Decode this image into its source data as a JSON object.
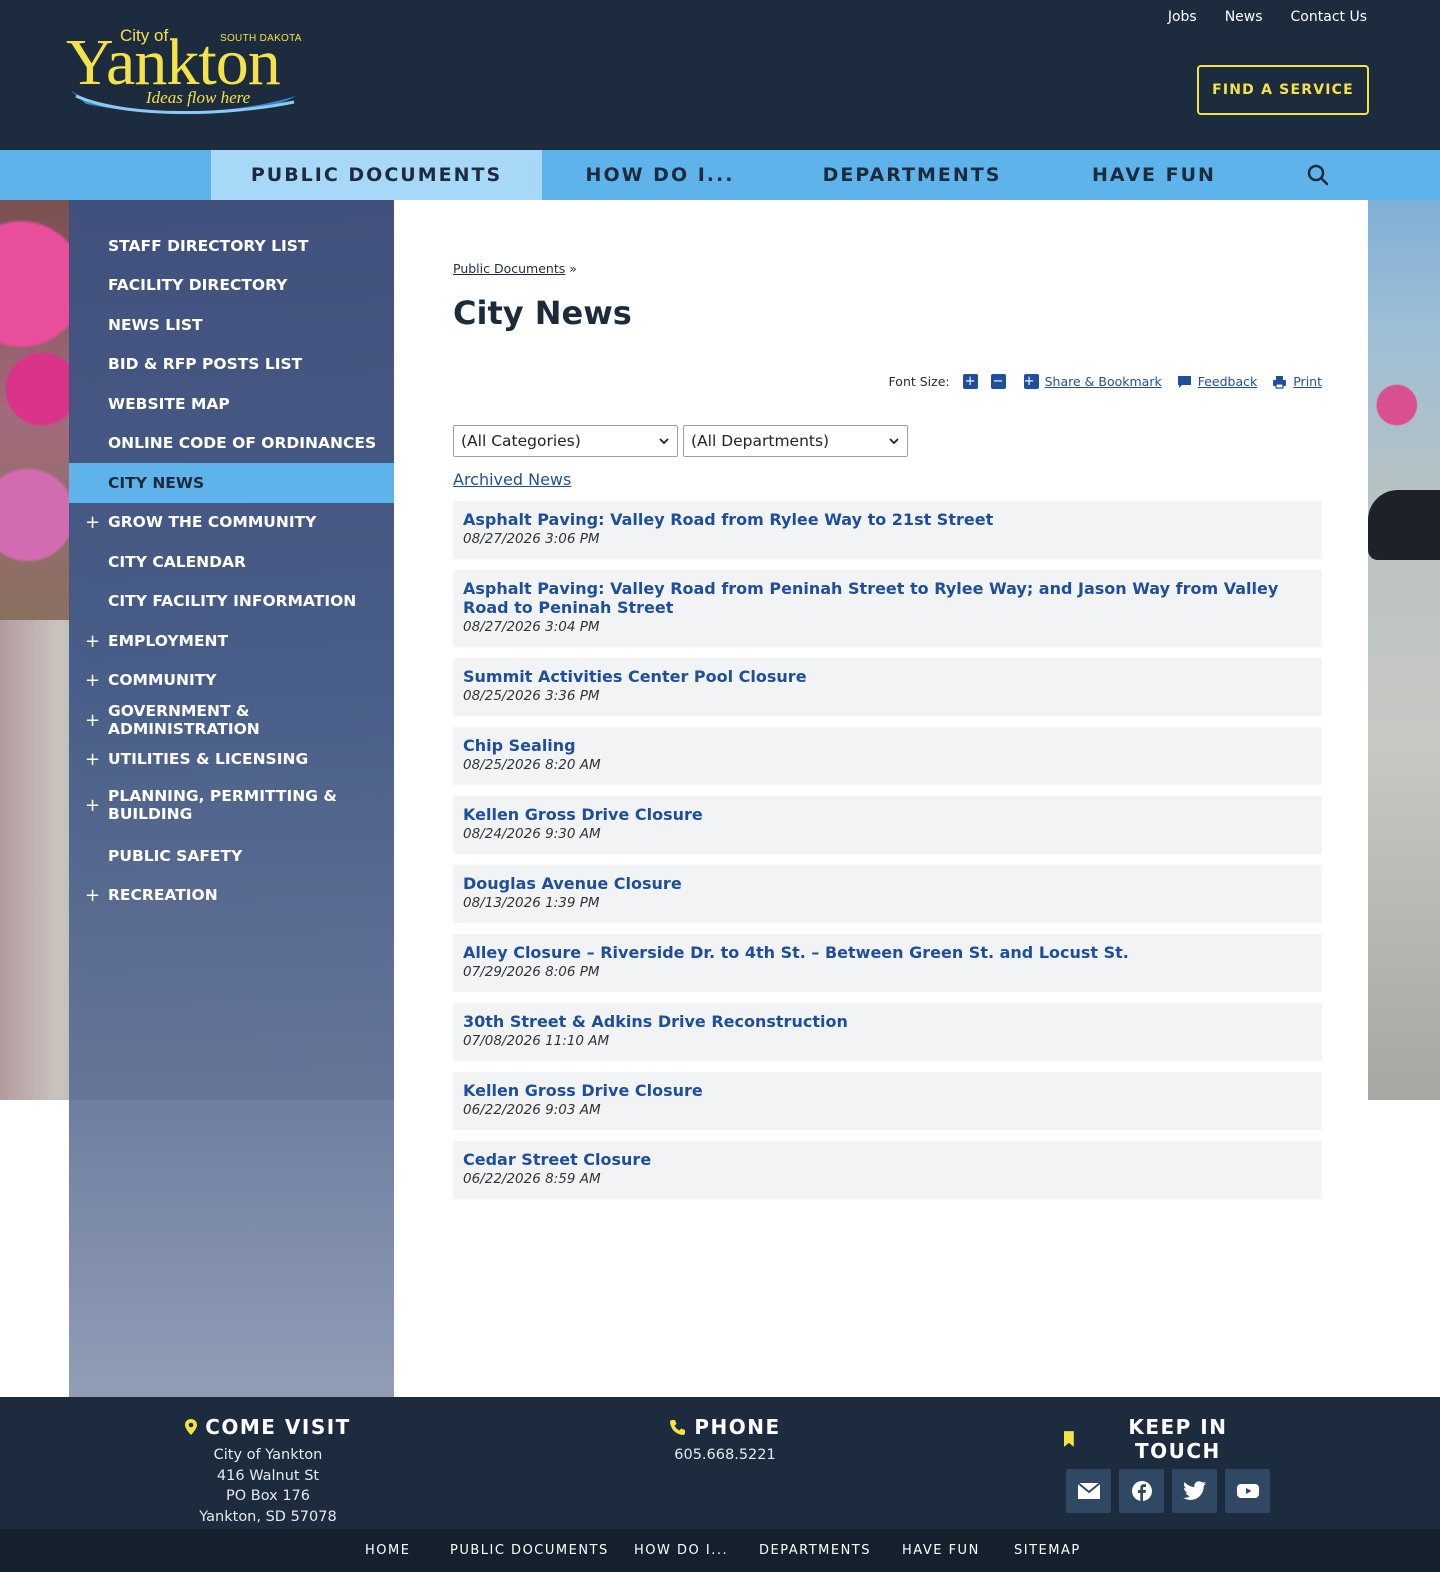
{
  "header": {
    "logo": {
      "city_of": "City of",
      "name": "Yankton",
      "state": "SOUTH DAKOTA",
      "tagline": "Ideas flow here"
    },
    "top_links": [
      "Jobs",
      "News",
      "Contact Us"
    ],
    "find_service_label": "FIND A SERVICE"
  },
  "main_nav": {
    "items": [
      "PUBLIC DOCUMENTS",
      "HOW DO I...",
      "DEPARTMENTS",
      "HAVE FUN"
    ],
    "active": "PUBLIC DOCUMENTS",
    "search_icon": "search-icon"
  },
  "sidebar": {
    "items": [
      {
        "label": "STAFF DIRECTORY LIST",
        "expandable": false
      },
      {
        "label": "FACILITY DIRECTORY",
        "expandable": false
      },
      {
        "label": "NEWS LIST",
        "expandable": false
      },
      {
        "label": "BID & RFP POSTS LIST",
        "expandable": false
      },
      {
        "label": "WEBSITE MAP",
        "expandable": false
      },
      {
        "label": "ONLINE CODE OF ORDINANCES",
        "expandable": false
      },
      {
        "label": "CITY NEWS",
        "expandable": false,
        "active": true
      },
      {
        "label": "GROW THE COMMUNITY",
        "expandable": true
      },
      {
        "label": "CITY CALENDAR",
        "expandable": false
      },
      {
        "label": "CITY FACILITY INFORMATION",
        "expandable": false
      },
      {
        "label": "EMPLOYMENT",
        "expandable": true
      },
      {
        "label": "COMMUNITY",
        "expandable": true
      },
      {
        "label": "GOVERNMENT & ADMINISTRATION",
        "expandable": true
      },
      {
        "label": "UTILITIES & LICENSING",
        "expandable": true
      },
      {
        "label": "PLANNING, PERMITTING & BUILDING",
        "expandable": true
      },
      {
        "label": "PUBLIC SAFETY",
        "expandable": false
      },
      {
        "label": "RECREATION",
        "expandable": true
      }
    ],
    "expand_symbol": "+"
  },
  "content": {
    "breadcrumb": {
      "link": "Public Documents",
      "separator": "»"
    },
    "title": "City News",
    "tools": {
      "font_size_label": "Font Size:",
      "increase_symbol": "+",
      "decrease_symbol": "−",
      "share_label": "Share & Bookmark",
      "feedback_label": "Feedback",
      "print_label": "Print"
    },
    "filters": {
      "category": "(All Categories)",
      "department": "(All Departments)"
    },
    "archived_label": "Archived News",
    "news": [
      {
        "title": "Asphalt Paving: Valley Road from Rylee Way to 21st Street",
        "date": "08/27/2026 3:06 PM"
      },
      {
        "title": "Asphalt Paving: Valley Road from Peninah Street to Rylee Way; and Jason Way from Valley Road to Peninah Street",
        "date": "08/27/2026 3:04 PM"
      },
      {
        "title": "Summit Activities Center Pool Closure",
        "date": "08/25/2026 3:36 PM"
      },
      {
        "title": "Chip Sealing",
        "date": "08/25/2026 8:20 AM"
      },
      {
        "title": "Kellen Gross Drive Closure",
        "date": "08/24/2026 9:30 AM"
      },
      {
        "title": "Douglas Avenue Closure",
        "date": "08/13/2026 1:39 PM"
      },
      {
        "title": "Alley Closure – Riverside Dr. to 4th St. – Between Green St. and Locust St.",
        "date": "07/29/2026 8:06 PM"
      },
      {
        "title": "30th Street & Adkins Drive Reconstruction",
        "date": "07/08/2026 11:10 AM"
      },
      {
        "title": "Kellen Gross Drive Closure",
        "date": "06/22/2026 9:03 AM"
      },
      {
        "title": "Cedar Street Closure",
        "date": "06/22/2026 8:59 AM"
      }
    ]
  },
  "footer": {
    "visit": {
      "heading": "COME VISIT",
      "lines": [
        "City of Yankton",
        "416 Walnut St",
        "PO Box 176",
        "Yankton, SD 57078"
      ]
    },
    "phone": {
      "heading": "PHONE",
      "number": "605.668.5221"
    },
    "touch": {
      "heading": "KEEP IN TOUCH",
      "icons": [
        "email-icon",
        "facebook-icon",
        "twitter-icon",
        "youtube-icon"
      ]
    },
    "bottom_links": [
      "HOME",
      "PUBLIC DOCUMENTS",
      "HOW DO I...",
      "DEPARTMENTS",
      "HAVE FUN",
      "SITEMAP"
    ]
  },
  "colors": {
    "header_bg": "#1d2b3e",
    "accent_yellow": "#f3e24a",
    "nav_blue": "#5eb4ea",
    "nav_active": "#a8d8f8",
    "link_blue": "#1f4f9c"
  }
}
